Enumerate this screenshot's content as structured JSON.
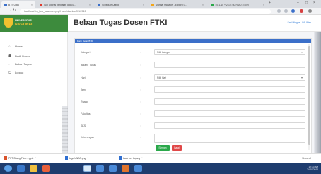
{
  "browser": {
    "tabs": [
      {
        "title": "BTS Ulasi",
        "color": "#3b6fc9"
      },
      {
        "title": "(10) tutorial pengajari data la...",
        "color": "#e03b2e"
      },
      {
        "title": "Schedule Uiangi",
        "color": "#3b6fc9"
      },
      {
        "title": "Manual Manakel - Editor Tu...",
        "color": "#f2a51a"
      },
      {
        "title": "TS 1-10 + 2-10 (30 RMC) Excel",
        "color": "#2aa84a"
      }
    ],
    "url": "localhost/sim_beo_uas/index.php/Home/dashbor/ft/1/2015"
  },
  "app": {
    "logo_line1": "UNIVERSITAS",
    "logo_line2": "NASIONAL",
    "page_title": "Beban Tugas Dosen FTKI",
    "user_link": "Sari Mingke - DS Web"
  },
  "sidebar": {
    "items": [
      {
        "label": "Home",
        "icon": "home-icon",
        "glyph": "⌂"
      },
      {
        "label": "Profil Dosen",
        "icon": "user-icon",
        "glyph": "☗"
      },
      {
        "label": "Beban Tugas",
        "icon": "book-icon",
        "glyph": "▪"
      },
      {
        "label": "Logout",
        "icon": "power-icon",
        "glyph": "⏻"
      }
    ]
  },
  "form": {
    "header": "Form Detail BTD",
    "fields": [
      {
        "label": "Kategori",
        "value": "Pilih kategori",
        "type": "select"
      },
      {
        "label": "Bidang Tugas",
        "value": "",
        "type": "text"
      },
      {
        "label": "Hari",
        "value": "Pilih Hari",
        "type": "select"
      },
      {
        "label": "Jam",
        "value": "",
        "type": "text"
      },
      {
        "label": "Ruang",
        "value": "",
        "type": "text"
      },
      {
        "label": "Fakultas",
        "value": "",
        "type": "text"
      },
      {
        "label": "SKS",
        "value": "",
        "type": "text"
      },
      {
        "label": "Keterangan",
        "value": "",
        "type": "textarea"
      }
    ],
    "separator": ":",
    "save_label": "Simpan",
    "cancel_label": "Batal"
  },
  "downloads": [
    {
      "name": "PPT Bilang Filep....pptx"
    },
    {
      "name": "logo UNAS.png"
    },
    {
      "name": "back per bujang"
    }
  ],
  "downloads_show_all": "Show all",
  "tray": {
    "time": "12:33 AM",
    "date": "24/10/2016"
  }
}
